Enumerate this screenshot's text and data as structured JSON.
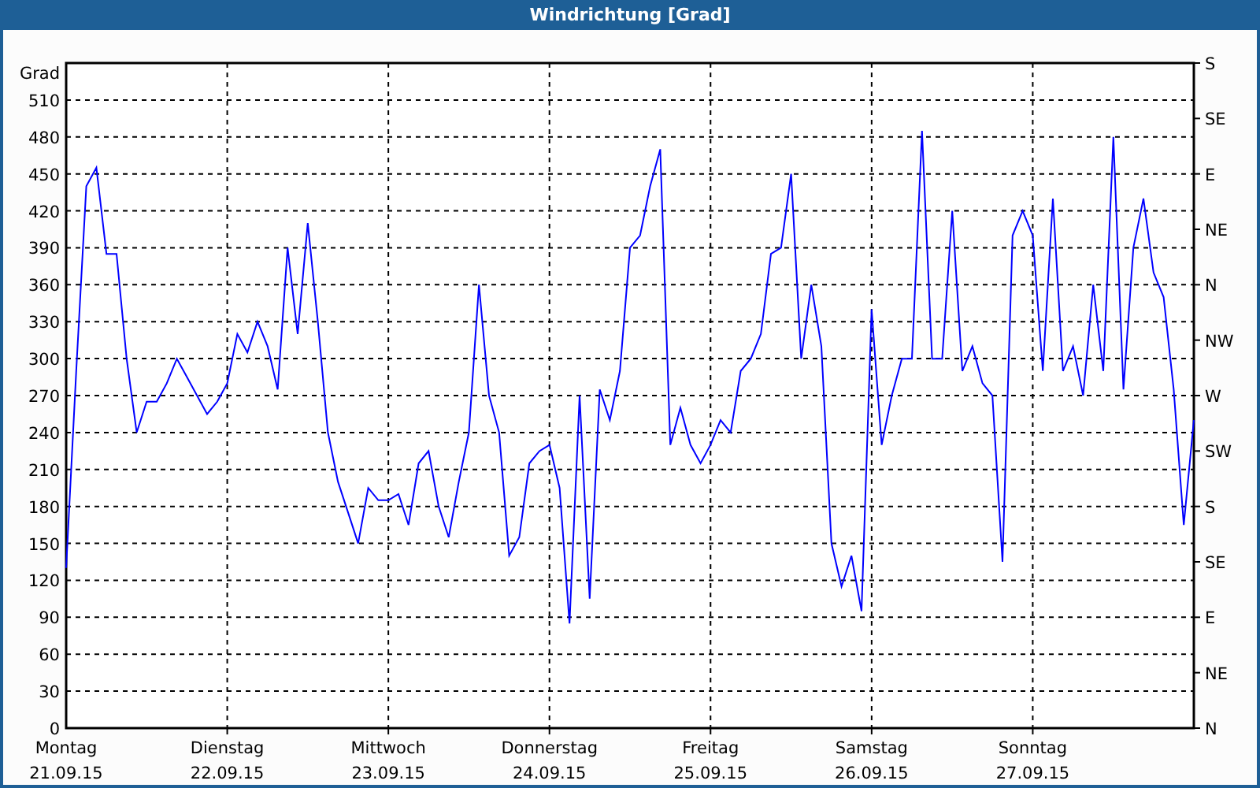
{
  "window": {
    "title": "Windrichtung [Grad]"
  },
  "chart_data": {
    "type": "line",
    "ylabel": "Grad",
    "ylim": [
      0,
      540
    ],
    "grid": true,
    "categories": [
      "Montag\n21.09.15",
      null,
      null,
      null,
      null,
      null,
      null,
      null,
      null,
      null,
      null,
      null,
      null,
      null,
      null,
      null,
      "Dienstag\n22.09.15",
      null,
      null,
      null,
      null,
      null,
      null,
      null,
      null,
      null,
      null,
      null,
      null,
      null,
      null,
      null,
      "Mittwoch\n23.09.15",
      null,
      null,
      null,
      null,
      null,
      null,
      null,
      null,
      null,
      null,
      null,
      null,
      null,
      null,
      null,
      "Donnerstag\n24.09.15",
      null,
      null,
      null,
      null,
      null,
      null,
      null,
      null,
      null,
      null,
      null,
      null,
      null,
      null,
      null,
      "Freitag\n25.09.15",
      null,
      null,
      null,
      null,
      null,
      null,
      null,
      null,
      null,
      null,
      null,
      null,
      null,
      null,
      null,
      "Samstag\n26.09.15",
      null,
      null,
      null,
      null,
      null,
      null,
      null,
      null,
      null,
      null,
      null,
      null,
      null,
      null,
      null,
      "Sonntag\n27.09.15",
      null,
      null,
      null,
      null,
      null,
      null,
      null,
      null,
      null,
      null,
      null,
      null,
      null,
      null,
      null,
      null
    ],
    "yticks": [
      0,
      30,
      60,
      90,
      120,
      150,
      180,
      210,
      240,
      270,
      300,
      330,
      360,
      390,
      420,
      450,
      480,
      510
    ],
    "series": [
      {
        "color": "#0000ff",
        "values": [
          130,
          290,
          440,
          455,
          385,
          385,
          300,
          240,
          265,
          265,
          280,
          300,
          285,
          270,
          255,
          265,
          280,
          320,
          305,
          330,
          310,
          275,
          390,
          320,
          410,
          330,
          240,
          200,
          175,
          150,
          195,
          185,
          185,
          190,
          165,
          215,
          225,
          180,
          155,
          200,
          240,
          360,
          270,
          240,
          140,
          155,
          215,
          225,
          230,
          195,
          85,
          270,
          105,
          275,
          250,
          290,
          390,
          400,
          440,
          470,
          230,
          260,
          230,
          215,
          230,
          250,
          240,
          290,
          300,
          320,
          385,
          390,
          450,
          300,
          360,
          310,
          150,
          115,
          140,
          95,
          340,
          230,
          270,
          300,
          300,
          485,
          300,
          300,
          420,
          290,
          310,
          280,
          270,
          135,
          400,
          420,
          400,
          290,
          430,
          290,
          310,
          270,
          360,
          290,
          480,
          275,
          390,
          430,
          370,
          350,
          275,
          165,
          250
        ]
      }
    ]
  },
  "compass_axis": {
    "ticks": [
      "S",
      "SE",
      "E",
      "NE",
      "N",
      "NW",
      "W",
      "SW",
      "S",
      "SE",
      "E",
      "NE",
      "N"
    ]
  }
}
